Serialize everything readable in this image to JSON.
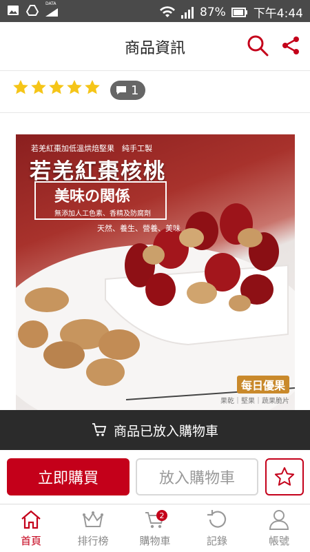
{
  "status_bar": {
    "battery": "87%",
    "time": "下午4:44",
    "data_label": "DATA"
  },
  "header": {
    "title": "商品資訊"
  },
  "rating": {
    "stars": 5,
    "comment_count": "1"
  },
  "product_image": {
    "tagline": "若羌紅棗加低溫烘焙堅果　純手工製",
    "title": "若羌紅棗核桃",
    "subtitle": "美味の関係",
    "note": "無添加人工色素、香精及防腐劑",
    "tags": "天然、養生、營養、美味",
    "brand": "每日優果",
    "brand_sub": "果乾｜堅果｜蔬果脆片"
  },
  "toast": {
    "message": "商品已放入購物車"
  },
  "actions": {
    "buy_now": "立即購買",
    "add_to_cart": "放入購物車"
  },
  "bottom_nav": {
    "items": [
      {
        "label": "首頁",
        "icon": "home-icon",
        "active": true
      },
      {
        "label": "排行榜",
        "icon": "crown-icon",
        "active": false
      },
      {
        "label": "購物車",
        "icon": "cart-icon",
        "active": false,
        "badge": "2"
      },
      {
        "label": "記錄",
        "icon": "history-icon",
        "active": false
      },
      {
        "label": "帳號",
        "icon": "user-icon",
        "active": false
      }
    ]
  },
  "colors": {
    "accent": "#c4001a",
    "toast_bg": "#2b2b2b",
    "star": "#f5c518"
  }
}
